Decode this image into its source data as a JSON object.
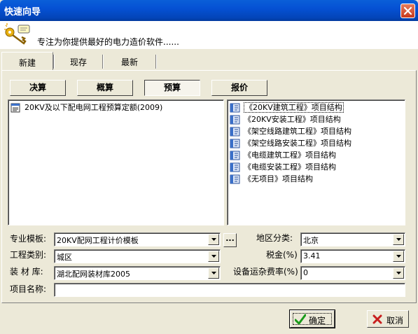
{
  "window": {
    "title": "快速向导"
  },
  "header": {
    "text": "专注为你提供最好的电力造价软件......"
  },
  "tabs": [
    {
      "label": "新建",
      "active": true
    },
    {
      "label": "现存",
      "active": false
    },
    {
      "label": "最新",
      "active": false
    }
  ],
  "type_buttons": [
    {
      "label": "决算",
      "active": false
    },
    {
      "label": "概算",
      "active": false
    },
    {
      "label": "预算",
      "active": true
    },
    {
      "label": "报价",
      "active": false
    }
  ],
  "left_list": [
    {
      "label": "20KV及以下配电网工程预算定额(2009)",
      "icon": "database-icon"
    }
  ],
  "right_list": [
    {
      "label": "《20KV建筑工程》项目结构",
      "icon": "book-icon",
      "selected": true
    },
    {
      "label": "《20KV安装工程》项目结构",
      "icon": "book-icon",
      "selected": false
    },
    {
      "label": "《架空线路建筑工程》项目结构",
      "icon": "book-icon",
      "selected": false
    },
    {
      "label": "《架空线路安装工程》项目结构",
      "icon": "book-icon",
      "selected": false
    },
    {
      "label": "《电缆建筑工程》项目结构",
      "icon": "book-icon",
      "selected": false
    },
    {
      "label": "《电缆安装工程》项目结构",
      "icon": "book-icon",
      "selected": false
    },
    {
      "label": "《无项目》项目结构",
      "icon": "book-icon",
      "selected": false
    }
  ],
  "form": {
    "template": {
      "label": "专业模板:",
      "value": "20KV配网工程计价模板"
    },
    "region": {
      "label": "地区分类:",
      "value": "北京"
    },
    "project_type": {
      "label": "工程类别:",
      "value": "城区"
    },
    "tax": {
      "label": "税金(%)",
      "value": "3.41"
    },
    "material_lib": {
      "label": "装 材 库:",
      "value": "湖北配网装材库2005"
    },
    "transport_rate": {
      "label": "设备运杂费率(%)",
      "value": "0"
    },
    "project_name": {
      "label": "项目名称:",
      "value": ""
    },
    "dots_label": "..."
  },
  "footer": {
    "ok_label": "确定",
    "cancel_label": "取消"
  },
  "colors": {
    "titlebar": "#0551d4",
    "dialog_bg": "#ece9d8",
    "close_button": "#c9381b",
    "ok_check": "#1a9a1a",
    "cancel_x": "#c81e1e"
  }
}
